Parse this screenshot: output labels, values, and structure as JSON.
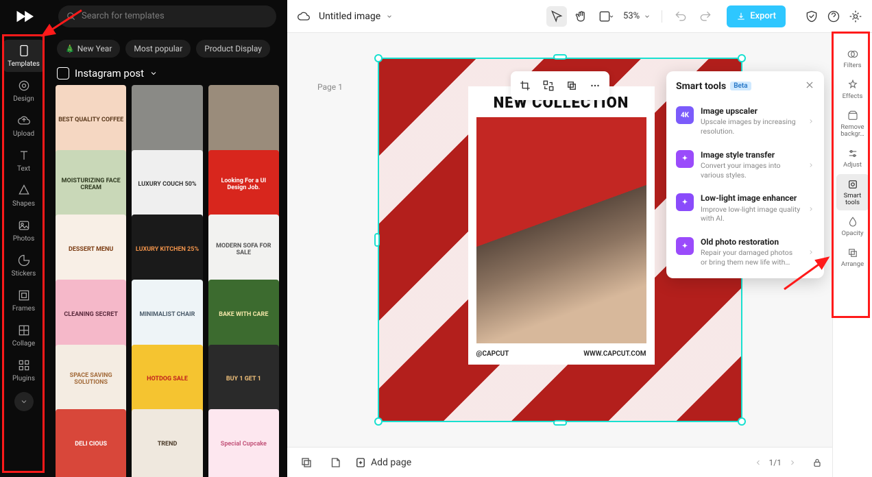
{
  "header": {
    "search_placeholder": "Search for templates",
    "title": "Untitled image",
    "zoom": "53%",
    "export": "Export"
  },
  "rail": {
    "items": [
      {
        "label": "Templates"
      },
      {
        "label": "Design"
      },
      {
        "label": "Upload"
      },
      {
        "label": "Text"
      },
      {
        "label": "Shapes"
      },
      {
        "label": "Photos"
      },
      {
        "label": "Stickers"
      },
      {
        "label": "Frames"
      },
      {
        "label": "Collage"
      },
      {
        "label": "Plugins"
      }
    ]
  },
  "chips": [
    {
      "label": "New Year"
    },
    {
      "label": "Most popular"
    },
    {
      "label": "Product Display"
    }
  ],
  "category": "Instagram post",
  "thumbs": [
    {
      "t": "BEST QUALITY COFFEE",
      "bg": "#f5d7c2",
      "fg": "#5b3a1d"
    },
    {
      "t": "",
      "bg": "#8a8a86",
      "fg": "#fff"
    },
    {
      "t": "",
      "bg": "#9a8c7b",
      "fg": "#fff"
    },
    {
      "t": "MOISTURIZING FACE CREAM",
      "bg": "#c9d8b8",
      "fg": "#2f3a20"
    },
    {
      "t": "LUXURY COUCH 50%",
      "bg": "#efefef",
      "fg": "#333"
    },
    {
      "t": "Looking For a UI Design Job.",
      "bg": "#d8261d",
      "fg": "#fff"
    },
    {
      "t": "DESSERT MENU",
      "bg": "#f8efe6",
      "fg": "#7a3b12"
    },
    {
      "t": "LUXURY KITCHEN 25%",
      "bg": "#1a1a1a",
      "fg": "#f0934b"
    },
    {
      "t": "MODERN SOFA FOR SALE",
      "bg": "#f2f2f0",
      "fg": "#555"
    },
    {
      "t": "CLEANING SECRET",
      "bg": "#f5b8c9",
      "fg": "#5b2a3d"
    },
    {
      "t": "MINIMALIST CHAIR",
      "bg": "#eef4f7",
      "fg": "#4a5b6a"
    },
    {
      "t": "BAKE WITH CARE",
      "bg": "#3c6b2f",
      "fg": "#f2e6a8"
    },
    {
      "t": "SPACE SAVING SOLUTIONS",
      "bg": "#f4ece2",
      "fg": "#a36b3a"
    },
    {
      "t": "HOTDOG SALE",
      "bg": "#f5c430",
      "fg": "#c0221d"
    },
    {
      "t": "BUY 1 GET 1",
      "bg": "#2a2a2a",
      "fg": "#f0c07a"
    },
    {
      "t": "DELI CIOUS",
      "bg": "#d8473a",
      "fg": "#fff"
    },
    {
      "t": "TREND",
      "bg": "#efe8de",
      "fg": "#4a3a28"
    },
    {
      "t": "Special Cupcake",
      "bg": "#fde7ef",
      "fg": "#c4577c"
    }
  ],
  "canvas": {
    "page_label": "Page 1",
    "poster_title": "NEW COLLECTION",
    "poster_handle": "@CAPCUT",
    "poster_url": "WWW.CAPCUT.COM"
  },
  "bottom": {
    "add_page": "Add page",
    "pager": "1/1"
  },
  "smart": {
    "title": "Smart tools",
    "beta": "Beta",
    "items": [
      {
        "title": "Image upscaler",
        "desc": "Upscale images by increasing resolution.",
        "badge": "4K",
        "color": "#7b5bfb"
      },
      {
        "title": "Image style transfer",
        "desc": "Convert your images into various styles.",
        "badge": "",
        "color": "#9a4bfb"
      },
      {
        "title": "Low-light image enhancer",
        "desc": "Improve low-light image quality with AI.",
        "badge": "",
        "color": "#8a4bfb"
      },
      {
        "title": "Old photo restoration",
        "desc": "Repair your damaged photos or bring them new life with…",
        "badge": "",
        "color": "#9a4bfb"
      }
    ]
  },
  "rrail": [
    {
      "label": "Filters"
    },
    {
      "label": "Effects"
    },
    {
      "label": "Remove backgr…"
    },
    {
      "label": "Adjust"
    },
    {
      "label": "Smart tools"
    },
    {
      "label": "Opacity"
    },
    {
      "label": "Arrange"
    }
  ]
}
